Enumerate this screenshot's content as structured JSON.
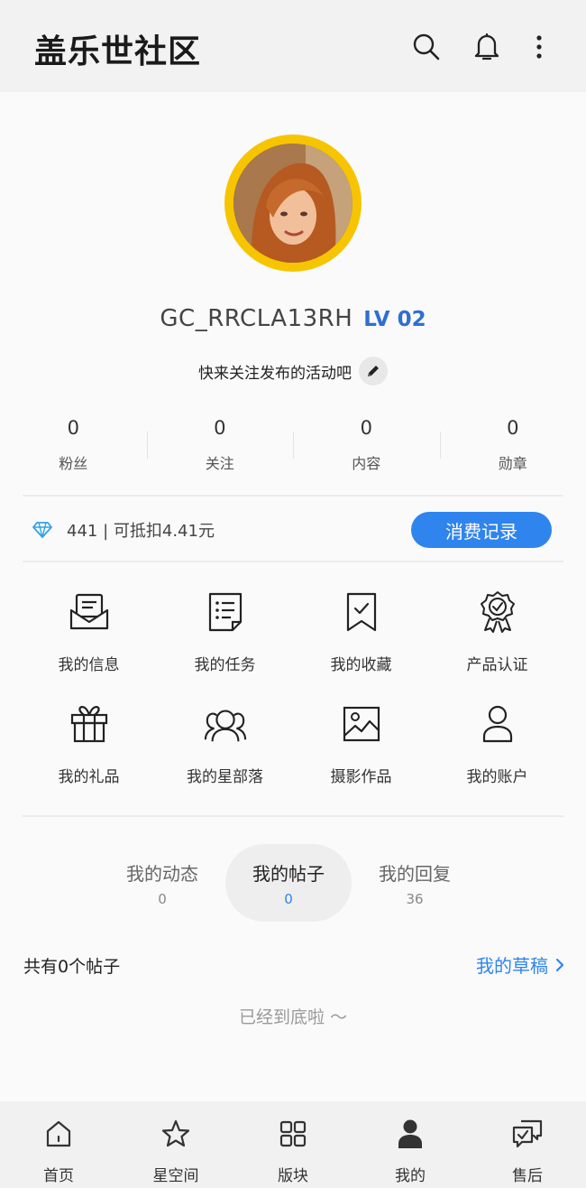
{
  "header": {
    "title": "盖乐世社区",
    "icons": [
      "search-icon",
      "bell-icon",
      "more-vertical-icon"
    ]
  },
  "profile": {
    "username": "GC_RRCLA13RH",
    "level": "LV 02",
    "bio": "快来关注发布的活动吧",
    "avatar_ring_color": "#f6c500"
  },
  "stats": [
    {
      "value": "0",
      "label": "粉丝"
    },
    {
      "value": "0",
      "label": "关注"
    },
    {
      "value": "0",
      "label": "内容"
    },
    {
      "value": "0",
      "label": "勋章"
    }
  ],
  "points": {
    "text": "441 | 可抵扣4.41元",
    "icon": "diamond-icon",
    "records_button": "消费记录"
  },
  "grid": [
    {
      "label": "我的信息",
      "icon": "message-envelope-icon"
    },
    {
      "label": "我的任务",
      "icon": "task-list-icon"
    },
    {
      "label": "我的收藏",
      "icon": "bookmark-icon"
    },
    {
      "label": "产品认证",
      "icon": "certified-badge-icon"
    },
    {
      "label": "我的礼品",
      "icon": "gift-icon"
    },
    {
      "label": "我的星部落",
      "icon": "community-icon"
    },
    {
      "label": "摄影作品",
      "icon": "photo-icon"
    },
    {
      "label": "我的账户",
      "icon": "user-icon"
    }
  ],
  "tabs": [
    {
      "label": "我的动态",
      "count": "0",
      "active": false
    },
    {
      "label": "我的帖子",
      "count": "0",
      "active": true
    },
    {
      "label": "我的回复",
      "count": "36",
      "active": false
    }
  ],
  "posts": {
    "summary": "共有0个帖子",
    "drafts_link": "我的草稿",
    "end_note": "已经到底啦 ～"
  },
  "bottom_nav": [
    {
      "label": "首页",
      "icon": "home-icon"
    },
    {
      "label": "星空间",
      "icon": "star-icon"
    },
    {
      "label": "版块",
      "icon": "grid-icon"
    },
    {
      "label": "我的",
      "icon": "user-filled-icon",
      "active": true
    },
    {
      "label": "售后",
      "icon": "support-chat-icon"
    }
  ],
  "colors": {
    "accent": "#2f84ee",
    "level": "#2f6fd4"
  }
}
